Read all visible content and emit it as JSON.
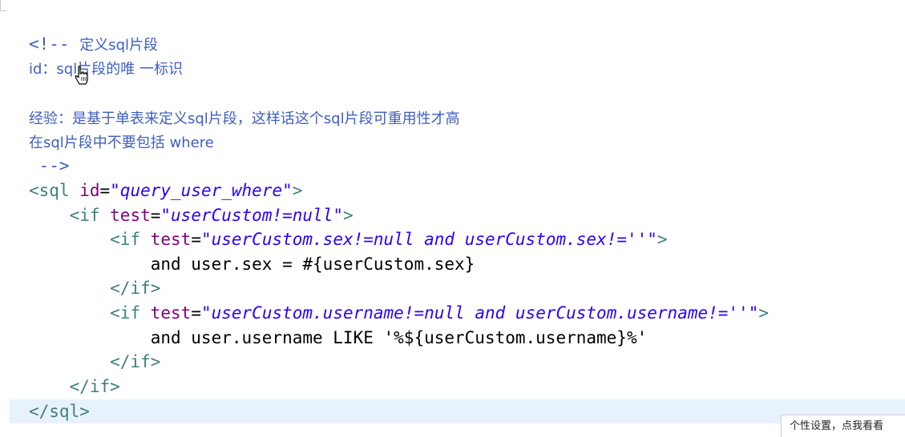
{
  "code": {
    "l1": {
      "open": "<!-- ",
      "text": "定义sql片段"
    },
    "l2": {
      "text": "id：sql片段的唯 一标识"
    },
    "l4": {
      "text": "经验：是基于单表来定义sql片段，这样话这个sql片段可重用性才高"
    },
    "l5": {
      "text": "在sql片段中不要包括 where"
    },
    "l6": {
      "close": " -->"
    },
    "l7": {
      "open": "<sql ",
      "attr": "id",
      "eq": "=",
      "value": "\"query_user_where\"",
      "close": ">"
    },
    "l8": {
      "indent": "    ",
      "open": "<if ",
      "attr": "test",
      "eq": "=",
      "value": "\"userCustom!=null\"",
      "close": ">"
    },
    "l9": {
      "indent": "        ",
      "open": "<if ",
      "attr": "test",
      "eq": "=",
      "value": "\"userCustom.sex!=null and userCustom.sex!=''\"",
      "close": ">"
    },
    "l10": {
      "indent": "            ",
      "text": "and user.sex = #{userCustom.sex}"
    },
    "l11": {
      "indent": "        ",
      "tag": "</if>"
    },
    "l12": {
      "indent": "        ",
      "open": "<if ",
      "attr": "test",
      "eq": "=",
      "value": "\"userCustom.username!=null and userCustom.username!=''\"",
      "close": ">"
    },
    "l13": {
      "indent": "            ",
      "text": "and user.username LIKE '%${userCustom.username}%'"
    },
    "l14": {
      "indent": "        ",
      "tag": "</if>"
    },
    "l15": {
      "indent": "    ",
      "tag": "</if>"
    },
    "l16": {
      "tag": "</sql>"
    }
  },
  "tooltip": {
    "text": "个性设置，点我看看"
  },
  "colors": {
    "comment": "#3f5fbf",
    "tag": "#3f7f7f",
    "attribute": "#7f007f",
    "value": "#2a00ff",
    "current_line": "#e8f2fe"
  },
  "icons": {
    "mouse_cursor": "hand-pointer-icon"
  }
}
